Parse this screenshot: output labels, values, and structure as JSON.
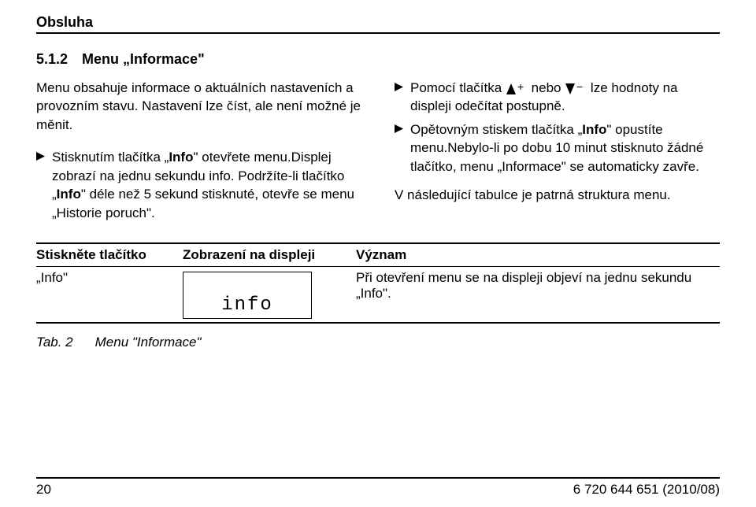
{
  "running_head": "Obsluha",
  "section": {
    "number": "5.1.2",
    "title": "Menu „Informace\""
  },
  "left": {
    "intro": "Menu obsahuje informace o aktuálních nastaveních a provozním stavu. Nastavení lze číst, ale není možné je měnit.",
    "b1_a": "Stisknutím tlačítka „",
    "b1_b": "Info",
    "b1_c": "\" otevřete menu.Displej zobrazí na jednu sekundu info. Podržíte-li tlačítko „",
    "b1_d": "Info",
    "b1_e": "\" déle než 5 sekund stisknuté, otevře se menu „Historie poruch\"."
  },
  "right": {
    "b1_a": "Pomocí tlačítka ",
    "b1_b": " nebo ",
    "b1_c": " lze hodnoty na displeji odečítat postupně.",
    "b2_a": "Opětovným stiskem tlačítka „",
    "b2_b": "Info",
    "b2_c": "\" opustíte menu.Nebylo-li po dobu 10 minut stisknuto žádné tlačítko, menu „Informace\" se automaticky zavře.",
    "after": "V následující tabulce je patrná struktura menu."
  },
  "table": {
    "h1": "Stiskněte tlačítko",
    "h2": "Zobrazení na displeji",
    "h3": "Význam",
    "r1c1": "„Info\"",
    "r1c3": "Při otevření menu se na displeji objeví na jednu sekundu „Info\".",
    "display": "info"
  },
  "caption": {
    "label": "Tab. 2",
    "text": "Menu \"Informace\""
  },
  "footer": {
    "page": "20",
    "ref": "6 720 644 651 (2010/08)"
  }
}
